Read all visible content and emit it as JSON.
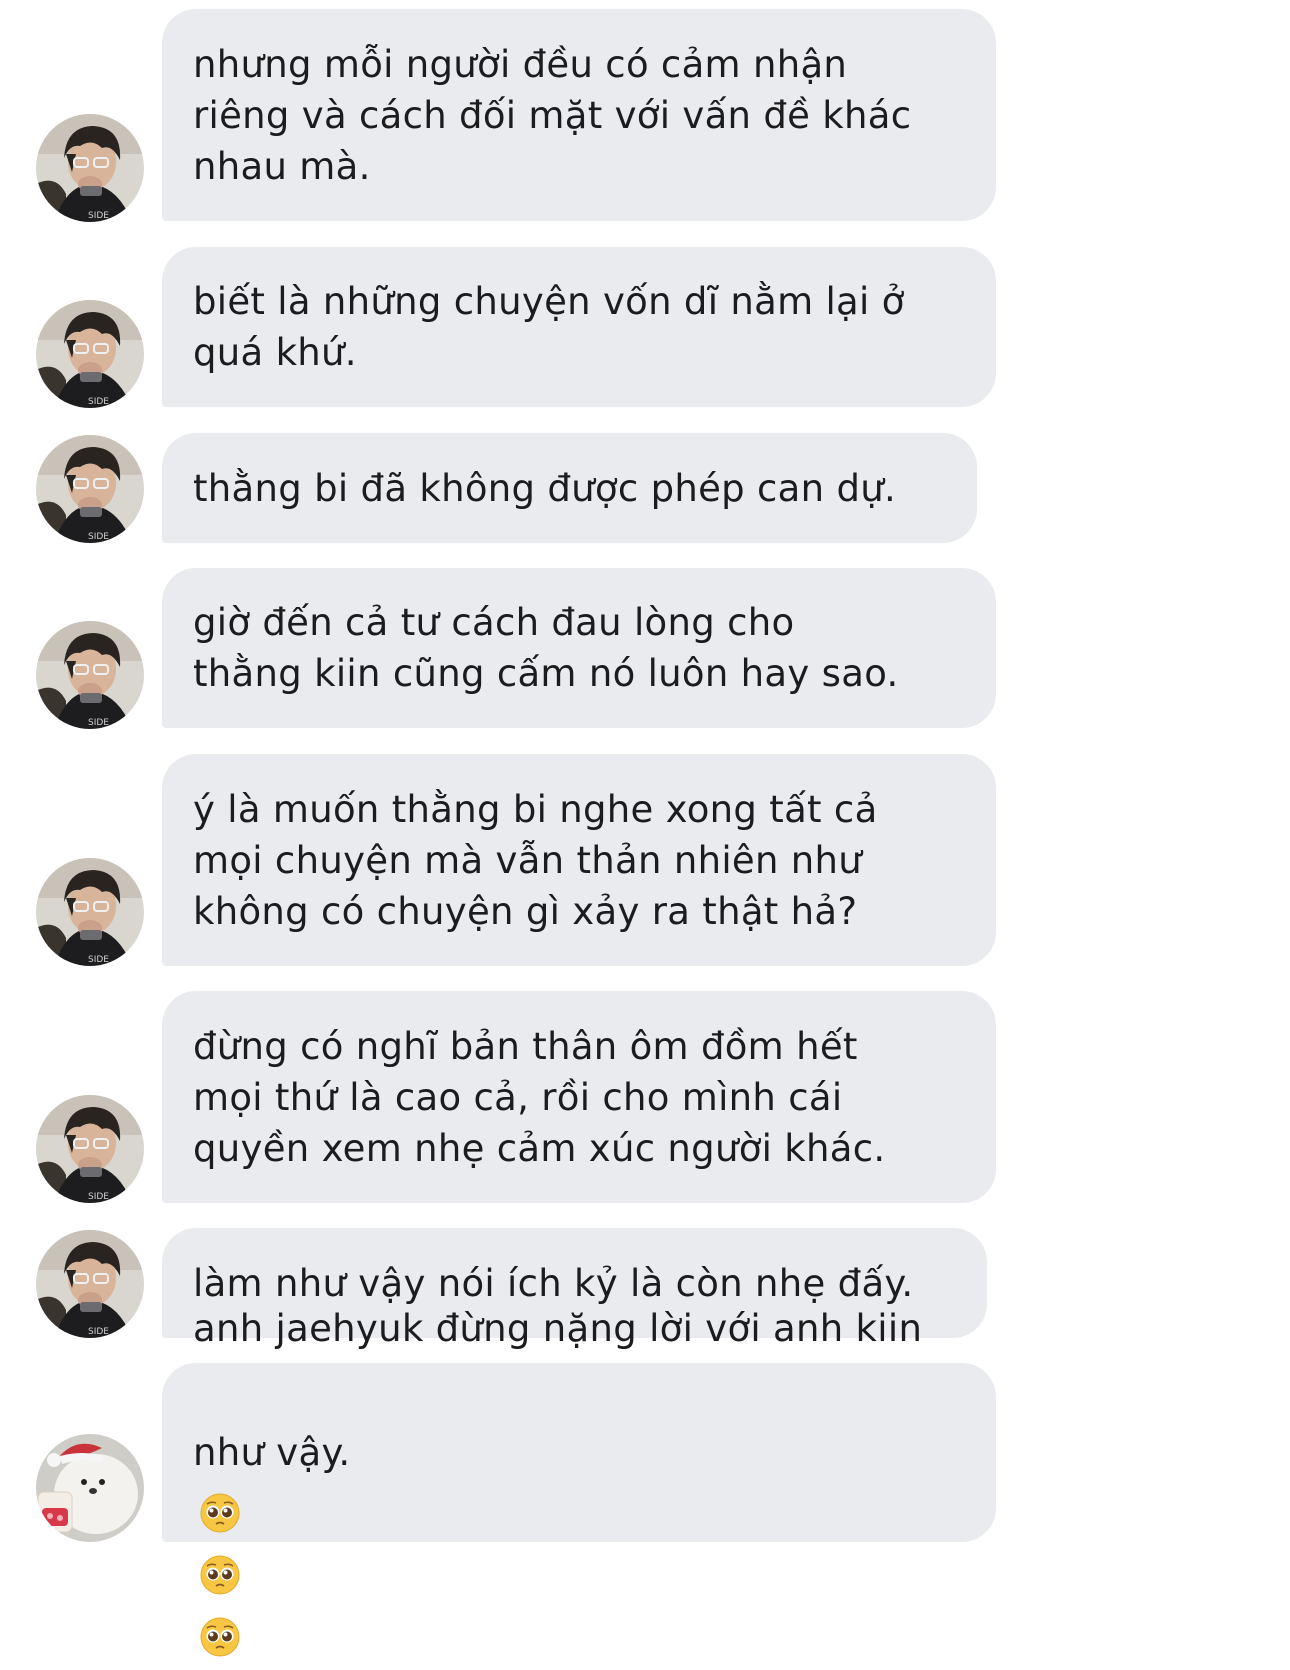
{
  "messages": [
    {
      "text": "nhưng mỗi người đều có cảm nhận\nriêng và cách đối mặt với vấn đề khác\nnhau mà.",
      "avatar": "guy-avatar"
    },
    {
      "text": "biết là những chuyện vốn dĩ nằm lại ở\nquá khứ.",
      "avatar": "guy-avatar"
    },
    {
      "text": "thằng bi đã không được phép can dự.",
      "avatar": "guy-avatar"
    },
    {
      "text": "giờ đến cả tư cách đau lòng cho\nthằng kiin cũng cấm nó luôn hay sao.",
      "avatar": "guy-avatar"
    },
    {
      "text": "ý là muốn thằng bi nghe xong tất cả\nmọi chuyện mà vẫn thản nhiên như\nkhông có chuyện gì xảy ra thật hả?",
      "avatar": "guy-avatar"
    },
    {
      "text": "đừng có nghĩ bản thân ôm đồm hết\nmọi thứ là cao cả, rồi cho mình cái\nquyền xem nhẹ cảm xúc người khác.",
      "avatar": "guy-avatar"
    },
    {
      "text": "làm như vậy nói ích kỷ là còn nhẹ đấy.",
      "avatar": "guy-avatar"
    },
    {
      "text_line1": "anh jaehyuk đừng nặng lời với anh kiin",
      "text_line2": "như vậy.",
      "emojis": [
        "pleading-face-emoji",
        "pleading-face-emoji",
        "pleading-face-emoji"
      ],
      "avatar": "bear-avatar"
    }
  ],
  "colors": {
    "bubble": "#e9ebef",
    "text": "#1c1c1e",
    "background": "#ffffff"
  }
}
